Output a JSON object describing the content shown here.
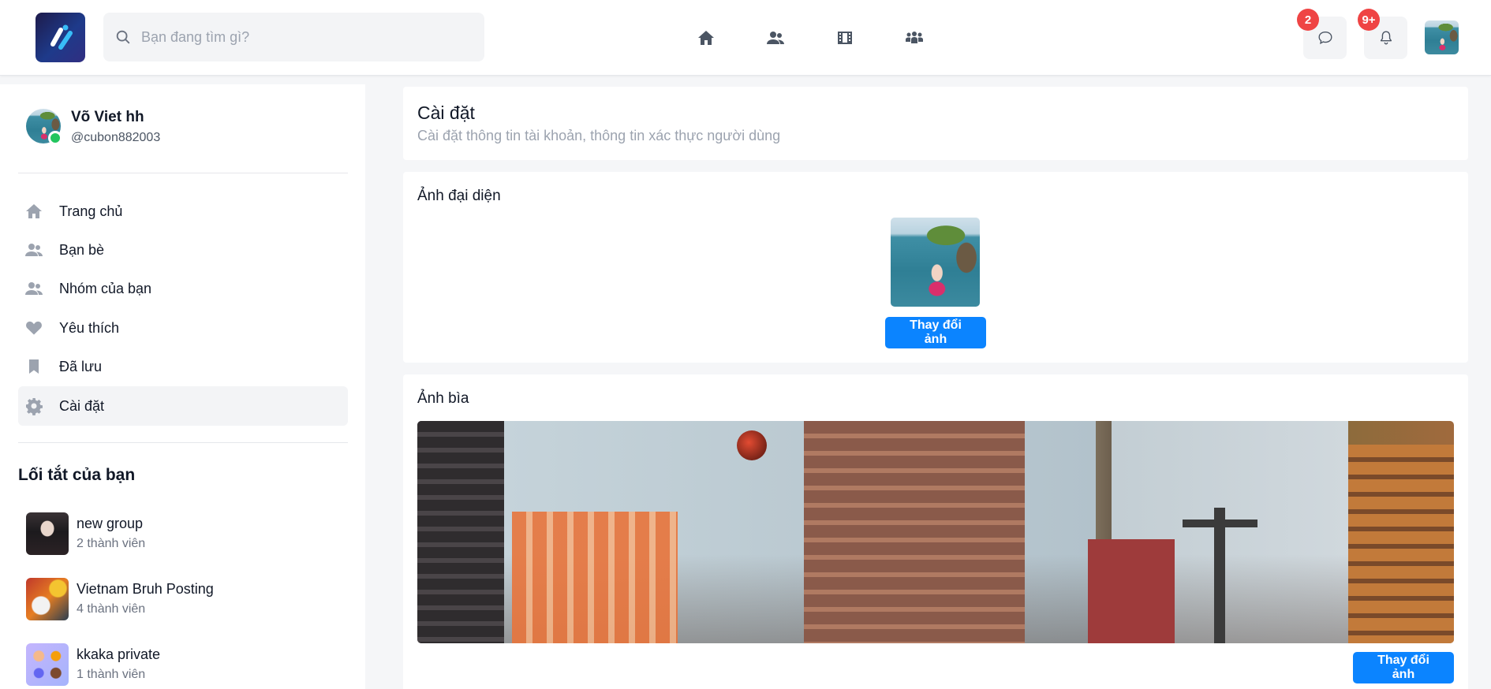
{
  "search": {
    "placeholder": "Bạn đang tìm gì?"
  },
  "notifications": {
    "messages_count": "2",
    "alerts_count": "9+"
  },
  "user": {
    "name": "Võ Viet hh",
    "handle": "@cubon882003"
  },
  "menu": [
    {
      "label": "Trang chủ",
      "icon": "home-icon"
    },
    {
      "label": "Bạn bè",
      "icon": "users-icon"
    },
    {
      "label": "Nhóm của bạn",
      "icon": "group-icon"
    },
    {
      "label": "Yêu thích",
      "icon": "heart-icon"
    },
    {
      "label": "Đã lưu",
      "icon": "bookmark-icon"
    },
    {
      "label": "Cài đặt",
      "icon": "gear-icon"
    }
  ],
  "shortcuts": {
    "title": "Lối tắt của bạn",
    "items": [
      {
        "name": "new group",
        "meta": "2 thành viên"
      },
      {
        "name": "Vietnam Bruh Posting",
        "meta": "4 thành viên"
      },
      {
        "name": "kkaka private",
        "meta": "1 thành viên"
      }
    ]
  },
  "settings": {
    "title": "Cài đặt",
    "subtitle": "Cài đặt thông tin tài khoản, thông tin xác thực người dùng",
    "avatar_title": "Ảnh đại diện",
    "avatar_button": "Thay đổi ảnh",
    "cover_title": "Ảnh bìa",
    "cover_button": "Thay đổi ảnh"
  },
  "colors": {
    "accent": "#0b84ff",
    "badge": "#ef4444",
    "online": "#22c55e"
  }
}
